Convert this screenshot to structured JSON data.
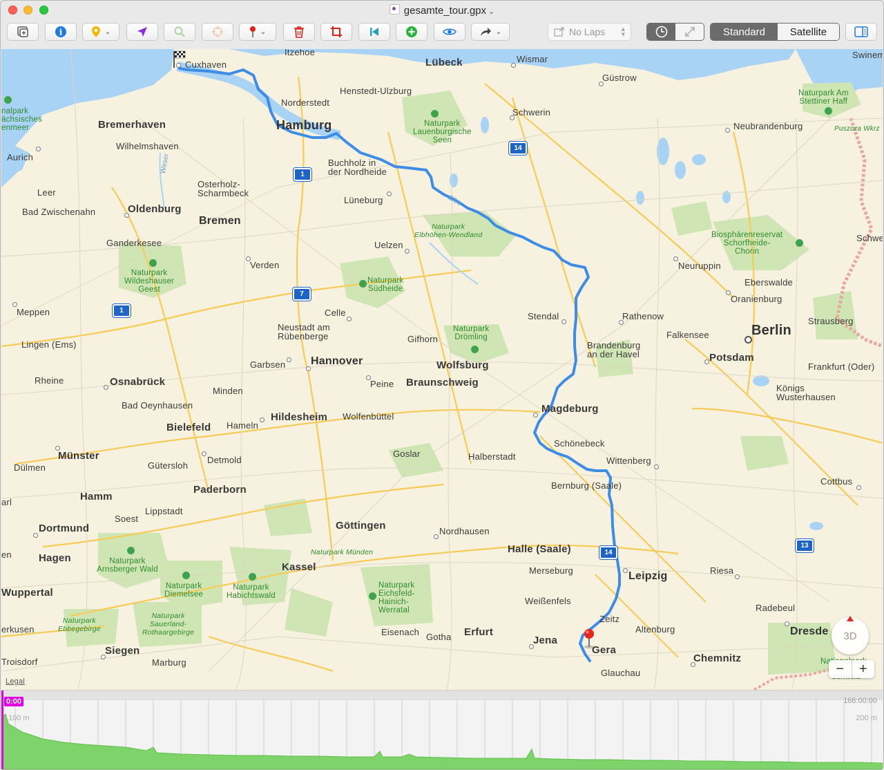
{
  "window": {
    "title": "gesamte_tour.gpx"
  },
  "toolbar": {
    "laps_label": "No Laps",
    "map_modes": [
      "Standard",
      "Satellite"
    ],
    "icons": [
      "new-window-icon",
      "info-icon",
      "marker-icon",
      "direction-icon",
      "search-icon",
      "target-icon",
      "pin-icon",
      "trash-icon",
      "crop-icon",
      "rewind-icon",
      "add-icon",
      "eye-icon",
      "share-icon",
      "clock-icon",
      "expand-icon",
      "sidebar-icon"
    ]
  },
  "map": {
    "cities_big": [
      "Hamburg",
      "Hannover",
      "Berlin",
      "Bremen"
    ],
    "labels": {
      "cuxhaven": "Cuxhaven",
      "itzehoe": "Itzehoe",
      "luebeck": "Lübeck",
      "wismar": "Wismar",
      "guestrow": "Güstrow",
      "swinemuende": "Swinem",
      "henstedt": "Henstedt-Ulzburg",
      "norderstedt": "Norderstedt",
      "schwerin": "Schwerin",
      "neubrandenburg": "Neubrandenburg",
      "bremerhaven": "Bremerhaven",
      "wilhelmshaven": "Wilhelmshaven",
      "aurich": "Aurich",
      "leer": "Leer",
      "bad_zwischenahn": "Bad Zwischenahn",
      "oldenburg": "Oldenburg",
      "osterholz": "Osterholz-\nScharmbeck",
      "buchholz": "Buchholz in\nder Nordheide",
      "lueneburg": "Lüneburg",
      "ganderkesee": "Ganderkesee",
      "verden": "Verden",
      "uelzen": "Uelzen",
      "neuruppin": "Neuruppin",
      "eberswalde": "Eberswalde",
      "oranienburg": "Oranienburg",
      "meppen": "Meppen",
      "celle": "Celle",
      "stendal": "Stendal",
      "rathenow": "Rathenow",
      "neustadt": "Neustadt am\nRübenberge",
      "gifhorn": "Gifhorn",
      "lingen": "Lingen (Ems)",
      "garbsen": "Garbsen",
      "wolfsburg": "Wolfsburg",
      "brandenburg": "Brandenburg\nan der Havel",
      "falkensee": "Falkensee",
      "strausberg": "Strausberg",
      "potsdam": "Potsdam",
      "rheine": "Rheine",
      "osnabrueck": "Osnabrück",
      "peine": "Peine",
      "braunschweig": "Braunschweig",
      "frankfurt_oder": "Frankfurt (Oder)",
      "minden": "Minden",
      "bad_oeynhausen": "Bad Oeynhausen",
      "koenigs": "Königs\nWusterhausen",
      "bielefeld": "Bielefeld",
      "hameln": "Hameln",
      "hildesheim": "Hildesheim",
      "wolfenbuettel": "Wolfenbüttel",
      "magdeburg": "Magdeburg",
      "schoenebeck": "Schönebeck",
      "muenster": "Münster",
      "detmold": "Detmold",
      "goslar": "Goslar",
      "halberstadt": "Halberstadt",
      "wittenberg": "Wittenberg",
      "guetersloh": "Gütersloh",
      "duelmen": "Dülmen",
      "bernburg": "Bernburg (Saale)",
      "cottbus": "Cottbus",
      "hamm": "Hamm",
      "paderborn": "Paderborn",
      "lippstadt": "Lippstadt",
      "soest": "Soest",
      "dortmund": "Dortmund",
      "goettingen": "Göttingen",
      "nordhausen": "Nordhausen",
      "halle": "Halle (Saale)",
      "hagen": "Hagen",
      "merseburg": "Merseburg",
      "leipzig": "Leipzig",
      "riesa": "Riesa",
      "kassel": "Kassel",
      "wuppertal": "Wuppertal",
      "weissenfels": "Weißenfels",
      "radebeul": "Radebeul",
      "zeitz": "Zeitz",
      "eisenach": "Eisenach",
      "gotha": "Gotha",
      "erfurt": "Erfurt",
      "jena": "Jena",
      "altenburg": "Altenburg",
      "dresden": "Dresde",
      "gera": "Gera",
      "siegen": "Siegen",
      "marburg": "Marburg",
      "chemnitz": "Chemnitz",
      "glauchau": "Glauchau",
      "leverkusen": "erkusen",
      "troisdorf": "Troisdorf",
      "legal": "Legal",
      "arl": "arl",
      "en": "en",
      "schwe": "Schwe",
      "schweiz": "Schweiz",
      "nationalpark_w": "nalpark\nächsisches\nenmeer",
      "weser": "Weser",
      "elbe": "Elbe",
      "puszcza": "Puszcza Wkrz",
      "np_stettiner": "Naturpark Am\nStettiner Haff",
      "np_lauenburg": "Naturpark\nLauenburgische\nSeen",
      "np_elbhoehen": "Naturpark\nElbhöhen-Wendland",
      "np_wildeshauser": "Naturpark\nWildeshauser\nGeest",
      "np_suedheide": "Naturpark\nSüdheide",
      "np_droemling": "Naturpark\nDrömling",
      "np_schorfheide": "Biosphärenreservat\nSchorfheide-\nChorin",
      "np_arnsberg": "Naturpark\nArnsberger Wald",
      "np_diemelsee": "Naturpark\nDiemelsee",
      "np_habichtswald": "Naturpark\nHabichtswald",
      "np_muenden": "Naturpark Münden",
      "np_eichsfeld": "Naturpark\nEichsfeld-\nHainich-\nWerratal",
      "np_ebbegebirge": "Naturpark\nEbbegebirge",
      "np_sauerland": "Naturpark\nSauerland-\nRothaargebirge",
      "nationalpark_s": "Nationalpark"
    },
    "shields": [
      "14",
      "1",
      "1",
      "7",
      "1",
      "14",
      "13"
    ],
    "compass_label": "3D",
    "zoom_out": "−",
    "zoom_in": "+"
  },
  "elevation": {
    "start_time": "0:00",
    "end_time": "166:00:00",
    "alt_left": "100 m",
    "alt_right": "200 m"
  },
  "colors": {
    "route": "#3d8ce6",
    "water": "#a9d3f5",
    "park": "#cfe6b4",
    "land": "#f7f2df",
    "accent": "#e100e1",
    "elevation_fill": "#7fd36b"
  }
}
